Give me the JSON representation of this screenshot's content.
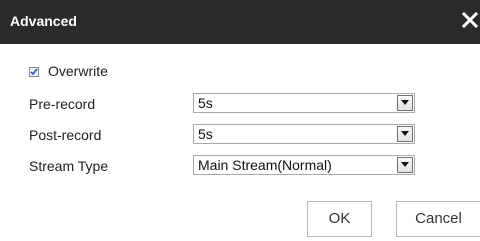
{
  "dialog": {
    "title": "Advanced",
    "close_icon": "close-icon"
  },
  "overwrite": {
    "label": "Overwrite",
    "checked": true
  },
  "fields": [
    {
      "label": "Pre-record",
      "value": "5s"
    },
    {
      "label": "Post-record",
      "value": "5s"
    },
    {
      "label": "Stream Type",
      "value": "Main Stream(Normal)"
    }
  ],
  "buttons": {
    "ok": "OK",
    "cancel": "Cancel"
  },
  "colors": {
    "titlebar": "#2b2b2b",
    "checkmark": "#2a52be"
  }
}
